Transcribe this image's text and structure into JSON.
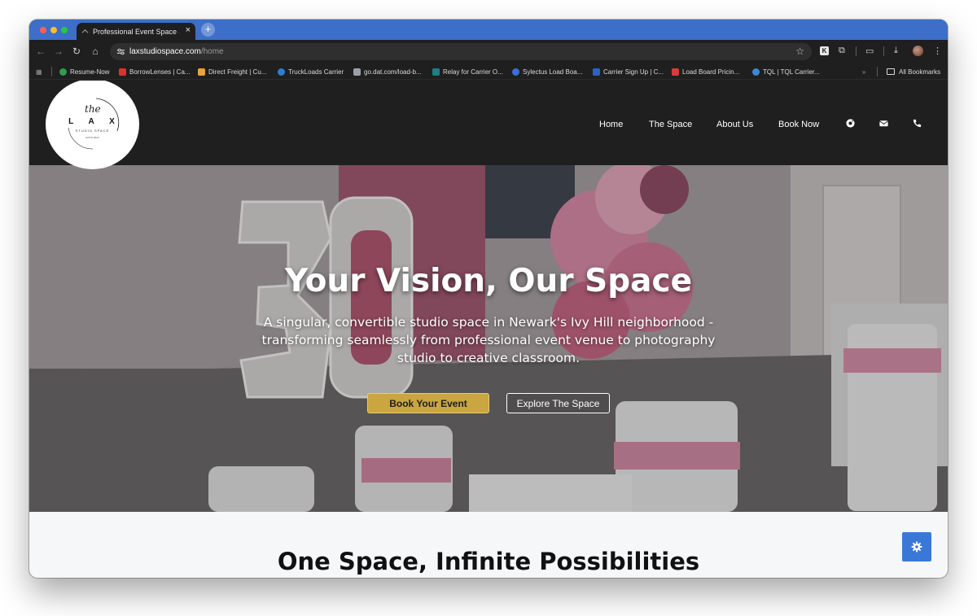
{
  "browser": {
    "tab_title": "Professional Event Space & S",
    "tab_close": "×",
    "new_tab": "+",
    "url_host": "laxstudiospace.com",
    "url_path": "/home",
    "bookmarks": [
      {
        "label": "Resume-Now",
        "color": "#2e9e4f"
      },
      {
        "label": "BorrowLenses | Ca...",
        "color": "#d9342b"
      },
      {
        "label": "Direct Freight | Cu...",
        "color": "#e8a33b"
      },
      {
        "label": "TruckLoads Carrier",
        "color": "#2f7dd1"
      },
      {
        "label": "go.dat.com/load-b...",
        "color": "#9aa0a6"
      },
      {
        "label": "Relay for Carrier O...",
        "color": "#1b7f86"
      },
      {
        "label": "Sylectus Load Boa...",
        "color": "#3a6fd8"
      },
      {
        "label": "Carrier Sign Up | C...",
        "color": "#2a62c9"
      },
      {
        "label": "Load Board Pricin...",
        "color": "#d93b3b"
      },
      {
        "label": "TQL | TQL Carrier...",
        "color": "#3a8bd6"
      }
    ],
    "bookmarks_overflow": "»",
    "all_bookmarks": "All Bookmarks"
  },
  "site": {
    "logo": {
      "the": "the",
      "name": "L A X",
      "sub": "STUDIO SPACE",
      "est": "EST'D 2023"
    },
    "nav": [
      "Home",
      "The Space",
      "About Us",
      "Book Now"
    ],
    "nav_icons": [
      "instagram-icon",
      "mail-icon",
      "phone-icon"
    ]
  },
  "hero": {
    "title": "Your Vision, Our Space",
    "subtitle": "A singular, convertible studio space in Newark's Ivy Hill neighborhood - transforming seamlessly from professional event venue to photography studio to creative classroom.",
    "primary_button": "Book Your Event",
    "secondary_button": "Explore The Space"
  },
  "section": {
    "title": "One Space, Infinite Possibilities"
  },
  "colors": {
    "accent_gold": "#c9a640",
    "fab_blue": "#3a78d8",
    "header_dark": "#1f1f1f",
    "tabstrip_blue": "#3d6fc9"
  }
}
